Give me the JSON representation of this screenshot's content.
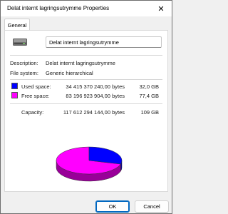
{
  "window": {
    "title": "Delat internt lagringsutrymme Properties",
    "close_glyph": "✕"
  },
  "tabs": [
    {
      "label": "General",
      "selected": true
    }
  ],
  "general": {
    "icon": "drive-icon",
    "name_value": "Delat internt lagringsutrymme",
    "description_label": "Description:",
    "description_value": "Delat internt lagringsutrymme",
    "filesystem_label": "File system:",
    "filesystem_value": "Generic hierarchical",
    "used": {
      "label": "Used space:",
      "bytes": "34 415 370 240,00 bytes",
      "size": "32,0 GB",
      "color": "#0000ff"
    },
    "free": {
      "label": "Free space:",
      "bytes": "83 196 923 904,00 bytes",
      "size": "77,4 GB",
      "color": "#ff00ff"
    },
    "capacity": {
      "label": "Capacity:",
      "bytes": "117 612 294 144,00 bytes",
      "size": "109 GB"
    },
    "chart_used_fraction": 0.2926
  },
  "buttons": {
    "ok": "OK",
    "cancel": "Cancel"
  }
}
